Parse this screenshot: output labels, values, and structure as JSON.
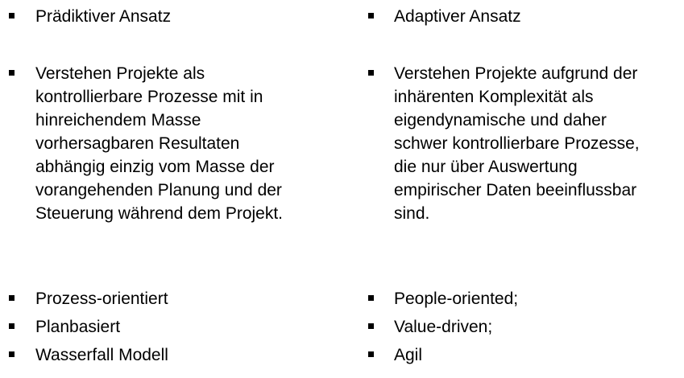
{
  "left": {
    "heading": "Prädiktiver Ansatz",
    "description_lines": [
      "Verstehen Projekte als",
      "kontrollierbare Prozesse mit in",
      "hinreichendem Masse",
      "vorhersagbaren Resultaten",
      "abhängig einzig vom Masse der",
      "vorangehenden Planung und der",
      "Steuerung während dem Projekt."
    ],
    "traits": [
      "Prozess-orientiert",
      "Planbasiert",
      "Wasserfall Modell"
    ]
  },
  "right": {
    "heading": "Adaptiver Ansatz",
    "description_lines": [
      "Verstehen Projekte aufgrund der",
      "inhärenten Komplexität als",
      "eigendynamische und daher",
      "schwer kontrollierbare Prozesse,",
      "die nur über Auswertung",
      "empirischer Daten beeinflussbar",
      "sind."
    ],
    "traits": [
      "People-oriented;",
      "Value-driven;",
      "Agil"
    ]
  }
}
